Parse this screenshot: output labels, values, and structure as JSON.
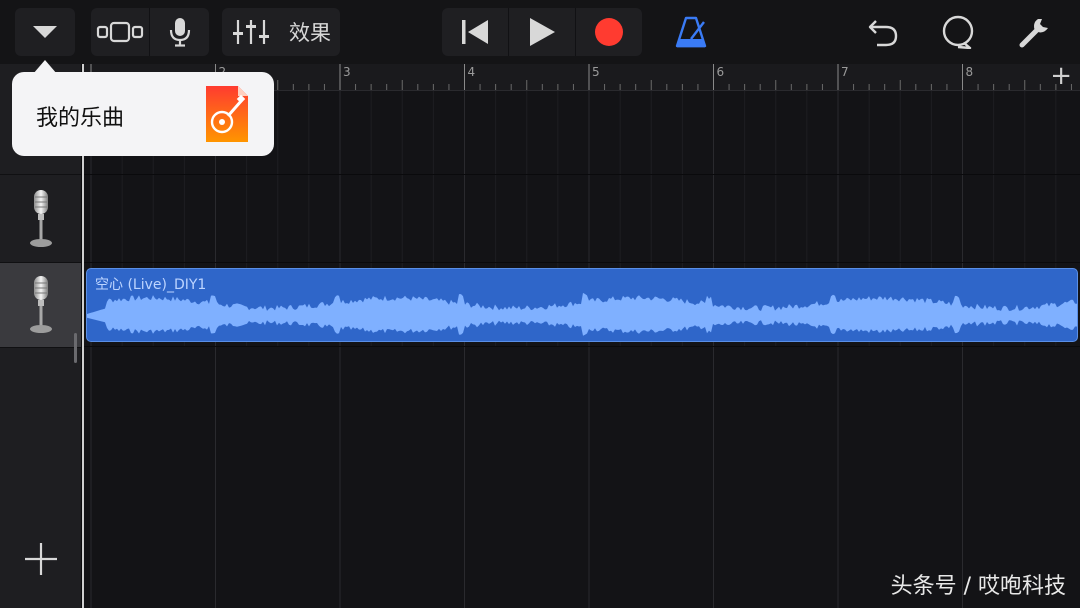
{
  "toolbar": {
    "effects_label": "效果",
    "icons": {
      "menu": "chevron-down-icon",
      "track_view": "tracks-view-icon",
      "mic": "microphone-icon",
      "mixer": "mixer-sliders-icon",
      "rewind": "skip-to-start-icon",
      "play": "play-icon",
      "record": "record-icon",
      "metronome": "metronome-icon",
      "undo": "undo-icon",
      "loop": "loop-browser-icon",
      "settings": "wrench-icon"
    },
    "colors": {
      "record": "#ff3b30",
      "metronome": "#3a7bf5"
    }
  },
  "popup": {
    "label": "我的乐曲",
    "app_icon": "garageband-icon"
  },
  "ruler": {
    "bars": [
      "2",
      "3",
      "4",
      "5",
      "6",
      "7",
      "8"
    ],
    "add_button": "+"
  },
  "tracks": [
    {
      "icon": "microphone-icon",
      "selected": false
    },
    {
      "icon": "microphone-icon",
      "selected": false
    },
    {
      "icon": "microphone-icon",
      "selected": true
    }
  ],
  "region": {
    "name": "空心 (Live)_DIY1",
    "color": "#2f66c9",
    "waveform_color": "#7fb0ff"
  },
  "sidebar": {
    "add_track": "+"
  },
  "watermark": "头条号 / 哎咆科技"
}
